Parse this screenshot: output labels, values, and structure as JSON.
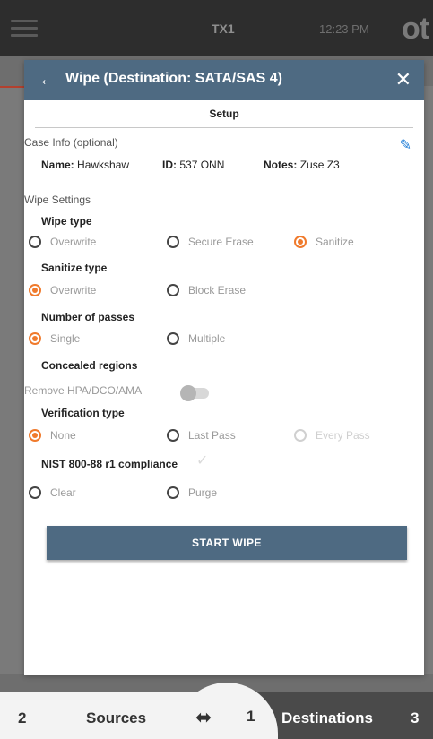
{
  "topbar": {
    "title": "TX1",
    "time": "12:23 PM",
    "brand": "ot"
  },
  "modal": {
    "back_icon": "arrow-left-icon",
    "title": "Wipe (Destination: SATA/SAS 4)",
    "close_icon": "close-icon",
    "tab": "Setup"
  },
  "case_info": {
    "section": "Case Info (optional)",
    "name_label": "Name:",
    "name_value": "Hawkshaw",
    "id_label": "ID:",
    "id_value": "537 ONN",
    "notes_label": "Notes:",
    "notes_value": "Zuse Z3"
  },
  "wipe_settings": {
    "section": "Wipe Settings",
    "wipe_type": {
      "label": "Wipe type",
      "options": [
        "Overwrite",
        "Secure Erase",
        "Sanitize"
      ],
      "selected": "Sanitize"
    },
    "sanitize_type": {
      "label": "Sanitize type",
      "options": [
        "Overwrite",
        "Block Erase"
      ],
      "selected": "Overwrite"
    },
    "passes": {
      "label": "Number of passes",
      "options": [
        "Single",
        "Multiple"
      ],
      "selected": "Single"
    },
    "concealed": {
      "label": "Concealed regions",
      "toggle_label": "Remove HPA/DCO/AMA",
      "toggle_on": false
    },
    "verification": {
      "label": "Verification type",
      "options": [
        "None",
        "Last Pass",
        "Every Pass"
      ],
      "selected": "None",
      "disabled": [
        "Every Pass"
      ]
    },
    "nist": {
      "label": "NIST 800-88 r1 compliance",
      "options": [
        "Clear",
        "Purge"
      ],
      "selected": null
    }
  },
  "start_button": "START WIPE",
  "bottombar": {
    "sources_count": "2",
    "sources_label": "Sources",
    "usb_count": "1",
    "destinations_label": "Destinations",
    "destinations_count": "3"
  },
  "colors": {
    "header": "#4e6a82",
    "accent": "#f07a2c",
    "edit_icon": "#1f7dd6"
  }
}
